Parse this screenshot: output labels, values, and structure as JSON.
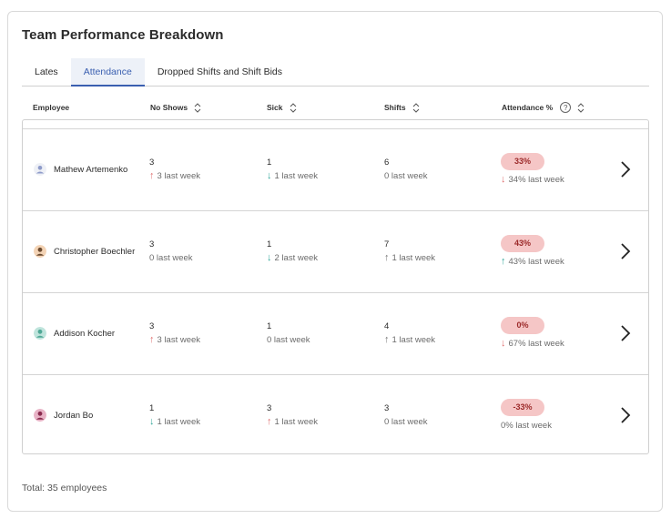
{
  "title": "Team Performance Breakdown",
  "tabs": [
    {
      "label": "Lates"
    },
    {
      "label": "Attendance"
    },
    {
      "label": "Dropped Shifts and Shift Bids"
    }
  ],
  "columns": {
    "employee": "Employee",
    "no_shows": "No Shows",
    "sick": "Sick",
    "shifts": "Shifts",
    "attendance": "Attendance %",
    "help": "?"
  },
  "rows": [
    {
      "name": "Mathew Artemenko",
      "avatar_color": "#c9d3ec",
      "no_shows": {
        "value": "3",
        "sub": "3 last week",
        "arrow": "↑"
      },
      "sick": {
        "value": "1",
        "sub": "1 last week",
        "arrow": "↓"
      },
      "shifts": {
        "value": "6",
        "sub": "0 last week",
        "arrow": ""
      },
      "attendance": {
        "value": "33%",
        "sub": "34% last week",
        "arrow": "↓"
      }
    },
    {
      "name": "Christopher Boechler",
      "avatar_color": "#e8b98f",
      "no_shows": {
        "value": "3",
        "sub": "0 last week",
        "arrow": ""
      },
      "sick": {
        "value": "1",
        "sub": "2 last week",
        "arrow": "↓"
      },
      "shifts": {
        "value": "7",
        "sub": "1 last week",
        "arrow": "↑"
      },
      "attendance": {
        "value": "43%",
        "sub": "43% last week",
        "arrow": "↑"
      }
    },
    {
      "name": "Addison Kocher",
      "avatar_color": "#7fc6b8",
      "no_shows": {
        "value": "3",
        "sub": "3 last week",
        "arrow": "↑"
      },
      "sick": {
        "value": "1",
        "sub": "0 last week",
        "arrow": ""
      },
      "shifts": {
        "value": "4",
        "sub": "1 last week",
        "arrow": "↑"
      },
      "attendance": {
        "value": "0%",
        "sub": "67% last week",
        "arrow": "↓"
      }
    },
    {
      "name": "Jordan Bo",
      "avatar_color": "#c0577a",
      "no_shows": {
        "value": "1",
        "sub": "1 last week",
        "arrow": "↓"
      },
      "sick": {
        "value": "3",
        "sub": "1 last week",
        "arrow": "↑"
      },
      "shifts": {
        "value": "3",
        "sub": "0 last week",
        "arrow": ""
      },
      "attendance": {
        "value": "-33%",
        "sub": "0% last week",
        "arrow": ""
      }
    }
  ],
  "footer": {
    "total": "Total: 35 employees"
  },
  "colors": {
    "accent": "#3a5fb0",
    "pill_bg": "#f5c6c6",
    "pill_text": "#9c2a2a",
    "up": "#e07070",
    "down": "#34a89c"
  }
}
